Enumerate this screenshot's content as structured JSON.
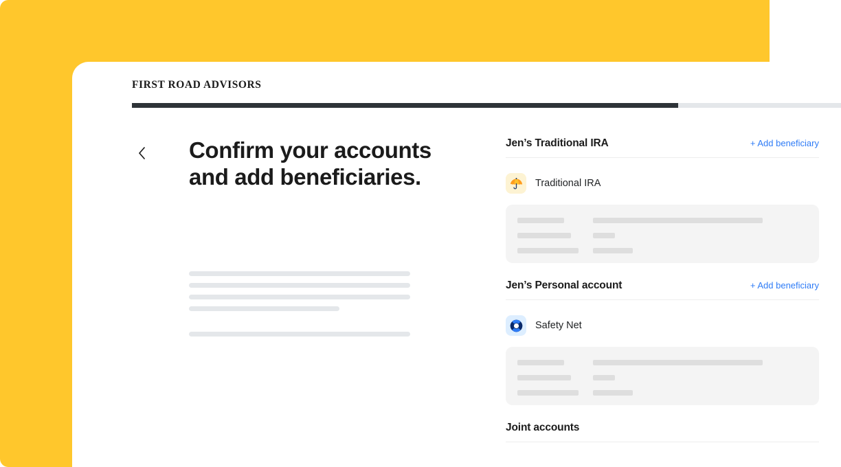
{
  "brand": {
    "name": "FIRST ROAD ADVISORS"
  },
  "progress": {
    "percent": 77,
    "fill_color": "#2e3338",
    "track_color": "#e4e7ea"
  },
  "theme": {
    "background_yellow": "#ffc72c",
    "card_white": "#ffffff",
    "link_blue": "#2f7cf6",
    "text_dark": "#1b1b1b",
    "skeleton_gray": "#e4e7ea",
    "card_gray": "#f4f4f4",
    "chip_gray": "#dedede"
  },
  "left": {
    "back_icon": "chevron-left-icon",
    "headline": "Confirm your accounts and add beneficiaries.",
    "skeleton_lines": [
      "w100",
      "w100",
      "w100",
      "w68",
      "w100"
    ]
  },
  "right": {
    "groups": [
      {
        "title": "Jen’s Traditional IRA",
        "add_label": "+ Add beneficiary",
        "has_add_link": true,
        "account": {
          "name": "Traditional IRA",
          "icon": "umbrella-icon",
          "icon_bg": "#fdf3d3"
        },
        "has_card": true
      },
      {
        "title": "Jen’s Personal account",
        "add_label": "+ Add beneficiary",
        "has_add_link": true,
        "account": {
          "name": "Safety Net",
          "icon": "life-ring-icon",
          "icon_bg": "#ddeeff"
        },
        "has_card": true
      },
      {
        "title": "Joint accounts",
        "add_label": "",
        "has_add_link": false,
        "account": null,
        "has_card": false
      }
    ],
    "card_skeleton": {
      "rows": [
        {
          "left": "sc-a1",
          "right": "sc-b1"
        },
        {
          "left": "sc-a2",
          "right": "sc-b2"
        },
        {
          "left": "sc-a3",
          "right": "sc-b3"
        }
      ]
    }
  }
}
